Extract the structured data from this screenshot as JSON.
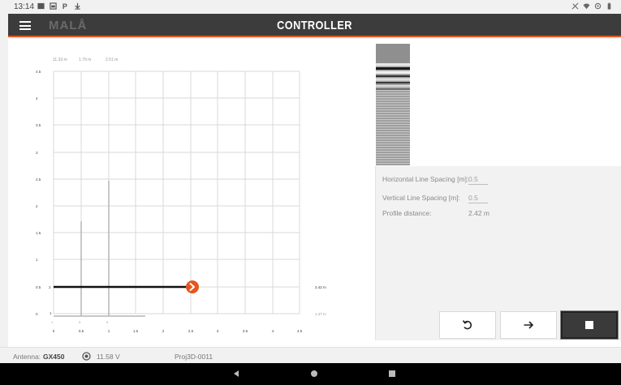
{
  "status": {
    "time": "13:14"
  },
  "appbar": {
    "logo": "MALÅ",
    "title": "CONTROLLER"
  },
  "plot": {
    "top_labels": [
      "11.33 m",
      "1.79 m",
      "2.51 m"
    ],
    "y_ticks": [
      "4.5",
      "4",
      "3.5",
      "3",
      "2.5",
      "2",
      "1.5",
      "1",
      "0.5",
      "0"
    ],
    "x_ticks": [
      "0",
      "0.5",
      "1",
      "1.5",
      "2",
      "2.5",
      "3",
      "3.5",
      "4",
      "4.5"
    ],
    "line_labels": [
      "2",
      "1"
    ],
    "small_labels": [
      "1",
      "3",
      "5"
    ],
    "right_labels": [
      "2.42 m",
      "1.47 m"
    ]
  },
  "settings": {
    "horizontal_label": "Horizontal Line Spacing [m]:",
    "horizontal_value": "0.5",
    "vertical_label": "Vertical Line Spacing [m]:",
    "vertical_value": "0.5",
    "distance_label": "Profile distance:",
    "distance_value": "2.42 m"
  },
  "footer": {
    "antenna_label": "Antenna:",
    "antenna_value": "GX450",
    "voltage": "11.58 V",
    "project": "Proj3D-0011"
  },
  "icons": {
    "menu": "menu-icon",
    "undo": "undo-icon",
    "next": "arrow-right-icon",
    "stop": "stop-icon",
    "battery": "battery-icon",
    "back": "back-icon",
    "home": "home-icon",
    "recents": "recents-icon"
  },
  "colors": {
    "accent": "#e6551e",
    "appbar": "#3c3c3c"
  }
}
